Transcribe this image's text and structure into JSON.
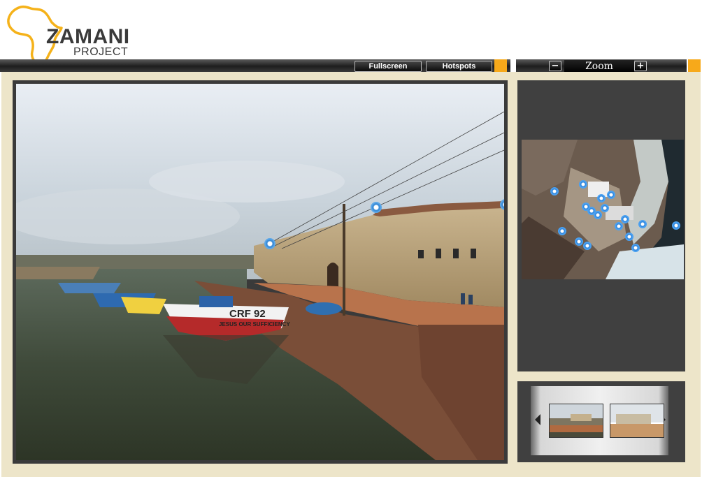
{
  "logo": {
    "title": "ZAMANI",
    "subtitle": "PROJECT"
  },
  "toolbar": {
    "fullscreen_label": "Fullscreen",
    "hotspots_label": "Hotspots",
    "zoom_label": "Zoom",
    "zoom_minus": "−",
    "zoom_plus": "+"
  },
  "panorama": {
    "boat_text_1": "CRF 92",
    "boat_text_2": "JESUS OUR SUFFICIENCY"
  },
  "map": {
    "hotspot_count": 21
  },
  "thumbnails": {
    "count": 2,
    "prev_icon": "left-arrow-icon",
    "next_icon": "right-arrow-icon"
  },
  "colors": {
    "accent_orange": "#f7a91a",
    "frame_cream": "#ede5c9",
    "panel_dark": "#404040",
    "hotspot_blue": "#3e8ed8"
  }
}
